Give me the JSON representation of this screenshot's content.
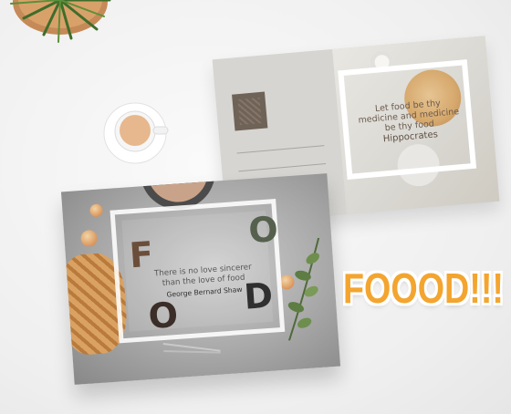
{
  "back_card": {
    "quote": "Let food be thy medicine and medicine be thy food",
    "author": "Hippocrates"
  },
  "front_card": {
    "letters": [
      "F",
      "O",
      "O",
      "D"
    ],
    "quote": "There is no love sincerer than the love of food",
    "author": "George Bernard Shaw"
  },
  "headline": "FOOOD!!!",
  "colors": {
    "headline": "#f3a52f",
    "stamp": "#6f6257",
    "letter_brown": "#6b4e3a",
    "letter_green": "#55604d"
  }
}
